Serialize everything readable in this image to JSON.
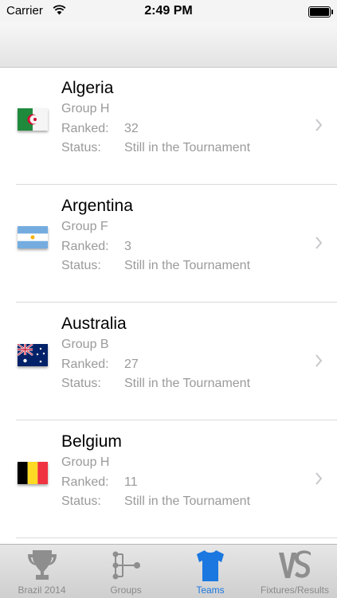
{
  "status_bar": {
    "carrier": "Carrier",
    "time": "2:49 PM"
  },
  "labels": {
    "ranked": "Ranked:",
    "status": "Status:"
  },
  "teams": [
    {
      "name": "Algeria",
      "group": "Group H",
      "rank": "32",
      "status": "Still in the Tournament",
      "flag": "algeria-flag-icon"
    },
    {
      "name": "Argentina",
      "group": "Group F",
      "rank": "3",
      "status": "Still in the Tournament",
      "flag": "argentina-flag-icon"
    },
    {
      "name": "Australia",
      "group": "Group B",
      "rank": "27",
      "status": "Still in the Tournament",
      "flag": "australia-flag-icon"
    },
    {
      "name": "Belgium",
      "group": "Group H",
      "rank": "11",
      "status": "Still in the Tournament",
      "flag": "belgium-flag-icon"
    }
  ],
  "tabs": [
    {
      "label": "Brazil 2014",
      "icon": "trophy-icon",
      "active": false
    },
    {
      "label": "Groups",
      "icon": "bracket-icon",
      "active": false
    },
    {
      "label": "Teams",
      "icon": "jersey-icon",
      "active": true
    },
    {
      "label": "Fixtures/Results",
      "icon": "vs-icon",
      "active": false
    }
  ],
  "colors": {
    "accent": "#1a78e0",
    "secondary_text": "#9a9a9a",
    "tab_inactive": "#8a8a8a"
  }
}
